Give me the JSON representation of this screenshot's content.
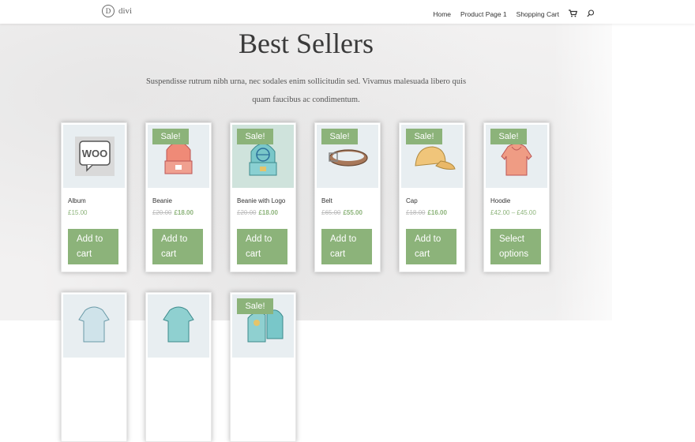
{
  "header": {
    "logo_text": "divi",
    "logo_mark": "D",
    "nav": [
      "Home",
      "Product Page 1",
      "Shopping Cart"
    ],
    "cart_icon": "cart-icon",
    "search_icon": "search-icon"
  },
  "main": {
    "title": "Best Sellers",
    "intro": "Suspendisse rutrum nibh urna, nec sodales enim sollicitudin sed. Vivamus malesuada libero quis quam faucibus ac condimentum."
  },
  "products": [
    {
      "name": "Album",
      "price": "£15.00",
      "old_price": "",
      "new_price": "",
      "sale": "",
      "button": "Add to cart"
    },
    {
      "name": "Beanie",
      "price": "",
      "old_price": "£20.00",
      "new_price": "£18.00",
      "sale": "Sale!",
      "button": "Add to cart"
    },
    {
      "name": "Beanie with Logo",
      "price": "",
      "old_price": "£20.00",
      "new_price": "£18.00",
      "sale": "Sale!",
      "button": "Add to cart"
    },
    {
      "name": "Belt",
      "price": "",
      "old_price": "£65.00",
      "new_price": "£55.00",
      "sale": "Sale!",
      "button": "Add to cart"
    },
    {
      "name": "Cap",
      "price": "",
      "old_price": "£18.00",
      "new_price": "£16.00",
      "sale": "Sale!",
      "button": "Add to cart"
    },
    {
      "name": "Hoodie",
      "price": "£42.00 – £45.00",
      "old_price": "",
      "new_price": "",
      "sale": "Sale!",
      "button": "Select options"
    }
  ],
  "products_row2": [
    {
      "sale": ""
    },
    {
      "sale": ""
    },
    {
      "sale": "Sale!"
    }
  ],
  "colors": {
    "accent": "#8cb37a",
    "text": "#333333",
    "background": "#f2f1f1"
  }
}
